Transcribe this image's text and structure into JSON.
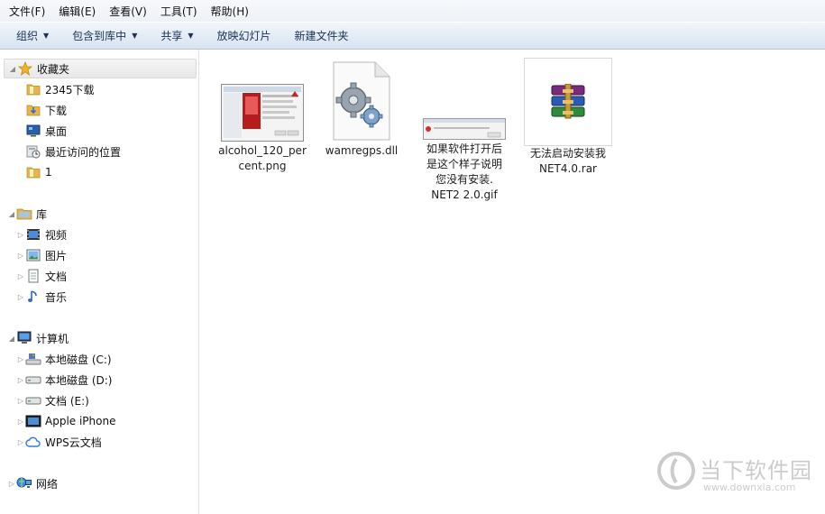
{
  "menu": [
    {
      "label": "文件(F)"
    },
    {
      "label": "编辑(E)"
    },
    {
      "label": "查看(V)"
    },
    {
      "label": "工具(T)"
    },
    {
      "label": "帮助(H)"
    }
  ],
  "toolbar": {
    "organize": "组织",
    "include_library": "包含到库中",
    "share": "共享",
    "slideshow": "放映幻灯片",
    "new_folder": "新建文件夹"
  },
  "nav": {
    "favorites": "收藏夹",
    "favorites_items": [
      "2345下载",
      "下载",
      "桌面",
      "最近访问的位置",
      "1"
    ],
    "libraries": "库",
    "libraries_items": [
      "视频",
      "图片",
      "文档",
      "音乐"
    ],
    "computer": "计算机",
    "computer_items": [
      "本地磁盘 (C:)",
      "本地磁盘 (D:)",
      "文档 (E:)",
      "Apple iPhone",
      "WPS云文档"
    ],
    "network": "网络"
  },
  "files": [
    {
      "name": "alcohol_120_percent.png",
      "label_lines": [
        "alcohol_120_per",
        "cent.png"
      ],
      "icon": "image-thumbnail-icon"
    },
    {
      "name": "wamregps.dll",
      "label_lines": [
        "wamregps.dll"
      ],
      "icon": "dll-gear-icon"
    },
    {
      "name": "如果软件打开后是这个样子说明您没有安装.NET2 2.0.gif",
      "label_lines": [
        "如果软件打开后",
        "是这个样子说明",
        "您没有安装.",
        "NET2 2.0.gif"
      ],
      "icon": "gif-thumbnail-icon"
    },
    {
      "name": "无法启动安装我NET4.0.rar",
      "label_lines": [
        "无法启动安装我",
        "NET4.0.rar"
      ],
      "icon": "winrar-archive-icon"
    }
  ],
  "watermark": {
    "brand": "当下软件园",
    "url": "www.downxia.com"
  },
  "colors": {
    "toolbar_text": "#1c3153",
    "selection": "#e8e8e8",
    "folder": "#e8b54a"
  }
}
